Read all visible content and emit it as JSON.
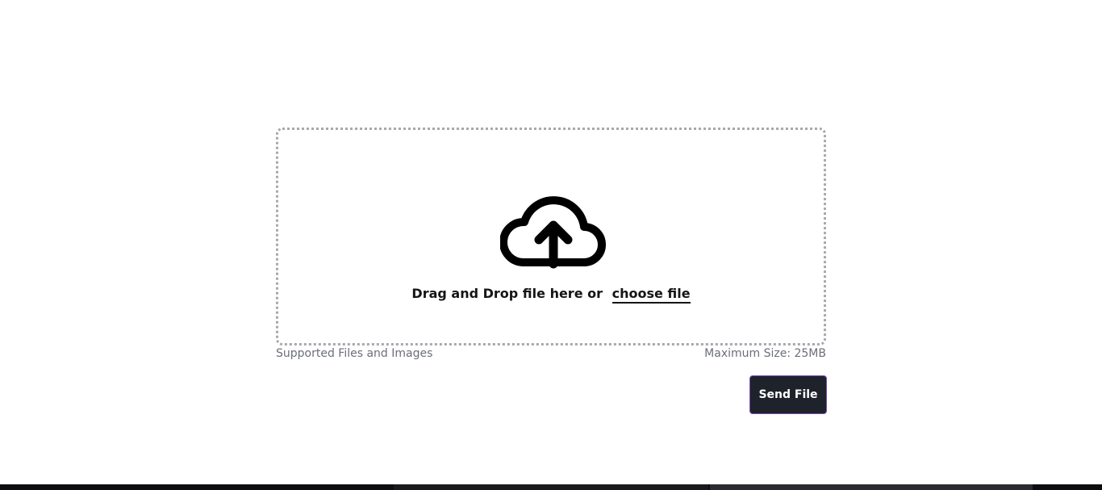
{
  "upload": {
    "drop_text": "Drag and Drop file here or",
    "choose_label": "choose file",
    "icon": "cloud-upload-icon"
  },
  "hints": {
    "supported": "Supported Files and Images",
    "max_size": "Maximum Size: 25MB"
  },
  "actions": {
    "send_label": "Send File"
  },
  "colors": {
    "button_bg": "#1e232b",
    "button_border": "#7b4bb8",
    "dropzone_border": "#a8a8ad",
    "hint_text": "#6b6f78"
  }
}
